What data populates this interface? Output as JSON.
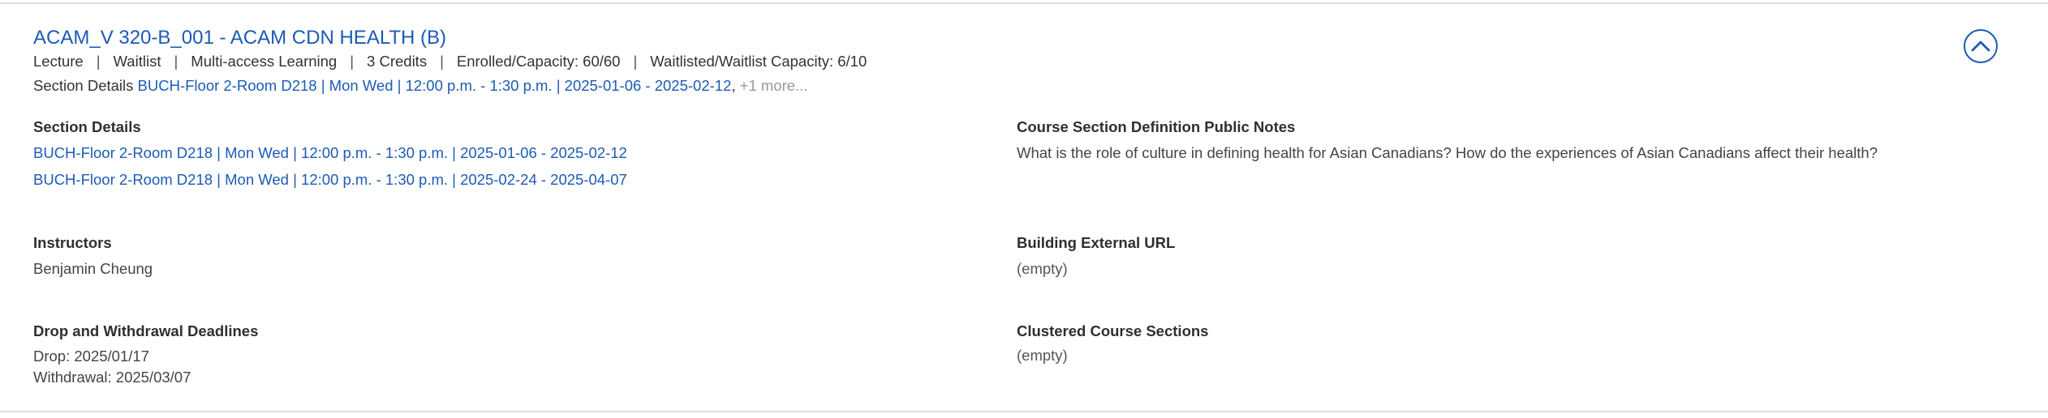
{
  "course": {
    "title": "ACAM_V 320-B_001 - ACAM CDN HEALTH (B)",
    "meta": [
      "Lecture",
      "Waitlist",
      "Multi-access Learning",
      "3 Credits",
      "Enrolled/Capacity: 60/60",
      "Waitlisted/Waitlist Capacity: 6/10"
    ],
    "summary": {
      "label": "Section Details",
      "link": "BUCH-Floor 2-Room D218 | Mon Wed | 12:00 p.m. - 1:30 p.m. | 2025-01-06 - 2025-02-12",
      "comma": ",",
      "more": "+1 more..."
    }
  },
  "collapse_icon": "chevron-up-icon",
  "accent_color": "#1c5bb5",
  "details": {
    "section_details": {
      "label": "Section Details",
      "items": [
        "BUCH-Floor 2-Room D218 | Mon Wed | 12:00 p.m. - 1:30 p.m. | 2025-01-06 - 2025-02-12",
        "BUCH-Floor 2-Room D218 | Mon Wed | 12:00 p.m. - 1:30 p.m. | 2025-02-24 - 2025-04-07"
      ]
    },
    "public_notes": {
      "label": "Course Section Definition Public Notes",
      "value": "What is the role of culture in defining health for Asian Canadians? How do the experiences of Asian Canadians affect their health?"
    },
    "instructors": {
      "label": "Instructors",
      "value": "Benjamin Cheung"
    },
    "building_url": {
      "label": "Building External URL",
      "value": "(empty)"
    },
    "deadlines": {
      "label": "Drop and Withdrawal Deadlines",
      "drop": "Drop: 2025/01/17",
      "withdrawal": "Withdrawal: 2025/03/07"
    },
    "clustered": {
      "label": "Clustered Course Sections",
      "value": "(empty)"
    }
  }
}
